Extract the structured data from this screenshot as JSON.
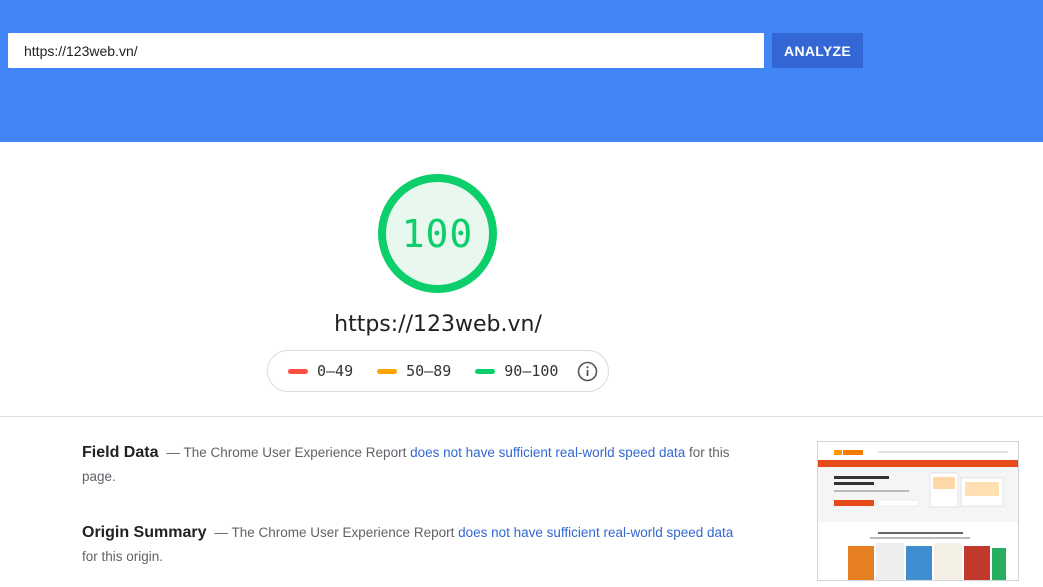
{
  "search": {
    "value": "https://123web.vn/",
    "analyze_label": "ANALYZE"
  },
  "result": {
    "score": "100",
    "url": "https://123web.vn/"
  },
  "legend": {
    "items": [
      {
        "label": "0–49",
        "color": "#ff4e42"
      },
      {
        "label": "50–89",
        "color": "#ffa400"
      },
      {
        "label": "90–100",
        "color": "#0cce6b"
      }
    ]
  },
  "field_data": {
    "title": "Field Data",
    "text_before": "— The Chrome User Experience Report ",
    "link": "does not have sufficient real-world speed data",
    "text_after": " for this page."
  },
  "origin_summary": {
    "title": "Origin Summary",
    "text_before": "— The Chrome User Experience Report ",
    "link": "does not have sufficient real-world speed data",
    "text_after": " for this origin."
  },
  "colors": {
    "header": "#4285f4",
    "button": "#3367d6",
    "pass": "#0cce6b",
    "average": "#ffa400",
    "fail": "#ff4e42",
    "link": "#3367d6"
  }
}
